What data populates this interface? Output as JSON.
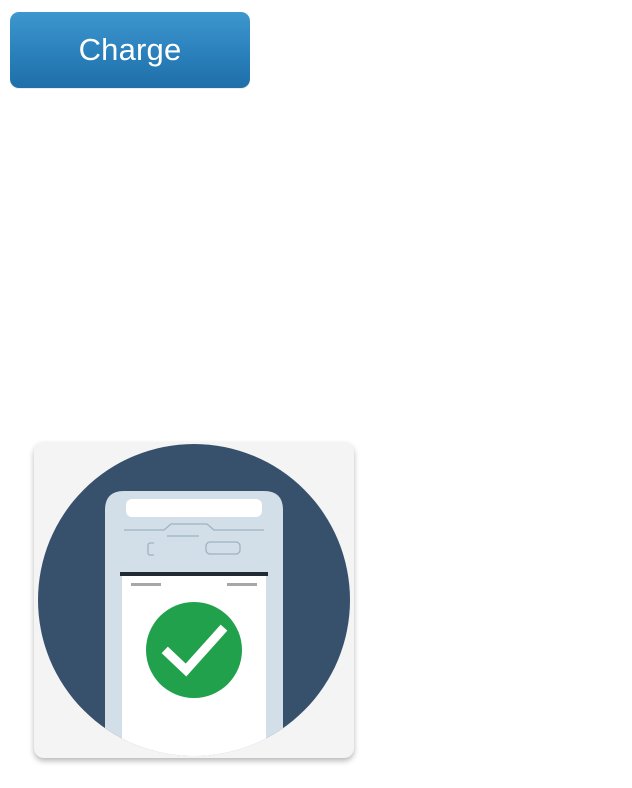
{
  "toolbar": {
    "charge_label": "Charge"
  },
  "illustration": {
    "icon": "payment-terminal-success-icon",
    "check_icon": "checkmark-icon"
  },
  "colors": {
    "button_top": "#3e97cf",
    "button_bottom": "#1f6fa8",
    "circle": "#37516d",
    "terminal_body": "#d3dfe8",
    "success_green": "#22a14d",
    "card_bg": "#f4f4f4"
  }
}
